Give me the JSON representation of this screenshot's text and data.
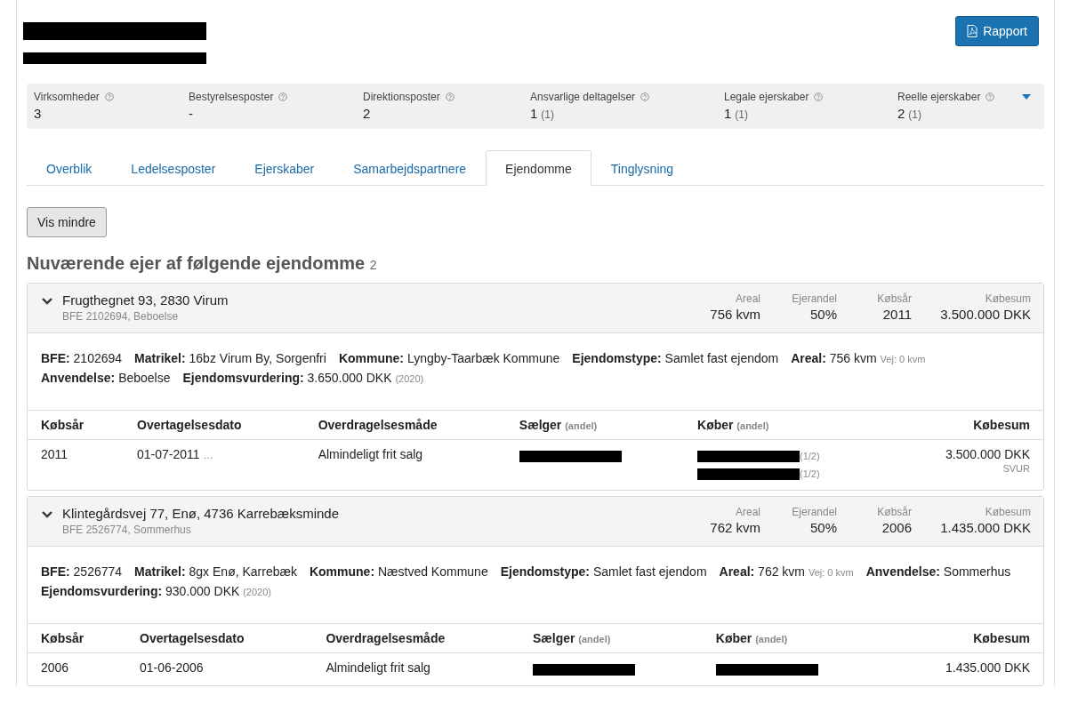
{
  "header": {
    "title": {
      "kind": "redacted"
    },
    "subtitle": {
      "kind": "redacted"
    },
    "report_button": "Rapport"
  },
  "stats": [
    {
      "label": "Virksomheder",
      "value": "3"
    },
    {
      "label": "Bestyrelsesposter",
      "value": "-"
    },
    {
      "label": "Direktionsposter",
      "value": "2"
    },
    {
      "label": "Ansvarlige deltagelser",
      "value": "1",
      "sub": "(1)"
    },
    {
      "label": "Legale ejerskaber",
      "value": "1",
      "sub": "(1)"
    },
    {
      "label": "Reelle ejerskaber",
      "value": "2",
      "sub": "(1)"
    }
  ],
  "tabs": [
    {
      "label": "Overblik",
      "selected": false
    },
    {
      "label": "Ledelsesposter",
      "selected": false
    },
    {
      "label": "Ejerskaber",
      "selected": false
    },
    {
      "label": "Samarbejdspartnere",
      "selected": false
    },
    {
      "label": "Ejendomme",
      "selected": true
    },
    {
      "label": "Tinglysning",
      "selected": false
    }
  ],
  "toggle_button": "Vis mindre",
  "section": {
    "title": "Nuværende ejer af følgende ejendomme",
    "count": "2"
  },
  "properties": [
    {
      "address": "Frugthegnet 93, 2830 Virum",
      "subtitle": "BFE 2102694, Beboelse",
      "expanded": true,
      "summary": [
        {
          "label": "Areal",
          "value": "756 kvm"
        },
        {
          "label": "Ejerandel",
          "value": "50%"
        },
        {
          "label": "Købsår",
          "value": "2011"
        },
        {
          "label": "Købesum",
          "value": "3.500.000 DKK"
        }
      ],
      "details": [
        {
          "label": "BFE:",
          "value": "2102694"
        },
        {
          "label": "Matrikel:",
          "value": "16bz Virum By, Sorgenfri"
        },
        {
          "label": "Kommune:",
          "value": "Lyngby-Taarbæk Kommune"
        },
        {
          "label": "Ejendomstype:",
          "value": "Samlet fast ejendom"
        },
        {
          "label": "Areal:",
          "value": "756 kvm",
          "note": "Vej: 0 kvm"
        },
        {
          "label": "Anvendelse:",
          "value": "Beboelse"
        },
        {
          "label": "Ejendomsvurdering:",
          "value": "3.650.000 DKK",
          "note": "(2020)"
        }
      ],
      "columns": [
        {
          "label": "Købsår"
        },
        {
          "label": "Overtagelsesdato"
        },
        {
          "label": "Overdragelsesmåde"
        },
        {
          "label": "Sælger",
          "note": "(andel)"
        },
        {
          "label": "Køber",
          "note": "(andel)"
        },
        {
          "label": "Købesum"
        }
      ],
      "rows": [
        {
          "year": "2011",
          "date": "01-07-2011",
          "date_more": "…",
          "method": "Almindeligt frit salg",
          "sellers": [
            {
              "kind": "redacted"
            }
          ],
          "buyers": [
            {
              "kind": "redacted",
              "share": "(1/2)"
            },
            {
              "kind": "redacted",
              "share": "(1/2)"
            }
          ],
          "price": "3.500.000 DKK",
          "price_note": "SVUR"
        }
      ]
    },
    {
      "address": "Klintegårdsvej 77, Enø, 4736 Karrebæksminde",
      "subtitle": "BFE 2526774, Sommerhus",
      "expanded": true,
      "summary": [
        {
          "label": "Areal",
          "value": "762 kvm"
        },
        {
          "label": "Ejerandel",
          "value": "50%"
        },
        {
          "label": "Købsår",
          "value": "2006"
        },
        {
          "label": "Købesum",
          "value": "1.435.000 DKK"
        }
      ],
      "details": [
        {
          "label": "BFE:",
          "value": "2526774"
        },
        {
          "label": "Matrikel:",
          "value": "8gx Enø, Karrebæk"
        },
        {
          "label": "Kommune:",
          "value": "Næstved Kommune"
        },
        {
          "label": "Ejendomstype:",
          "value": "Samlet fast ejendom"
        },
        {
          "label": "Areal:",
          "value": "762 kvm",
          "note": "Vej: 0 kvm"
        },
        {
          "label": "Anvendelse:",
          "value": "Sommerhus"
        },
        {
          "label": "Ejendomsvurdering:",
          "value": "930.000 DKK",
          "note": "(2020)"
        }
      ],
      "columns": [
        {
          "label": "Købsår"
        },
        {
          "label": "Overtagelsesdato"
        },
        {
          "label": "Overdragelsesmåde"
        },
        {
          "label": "Sælger",
          "note": "(andel)"
        },
        {
          "label": "Køber",
          "note": "(andel)"
        },
        {
          "label": "Købesum"
        }
      ],
      "rows": [
        {
          "year": "2006",
          "date": "01-06-2006",
          "method": "Almindeligt frit salg",
          "sellers": [
            {
              "kind": "redacted"
            }
          ],
          "buyers": [
            {
              "kind": "redacted"
            }
          ],
          "price": "1.435.000 DKK"
        }
      ]
    }
  ]
}
